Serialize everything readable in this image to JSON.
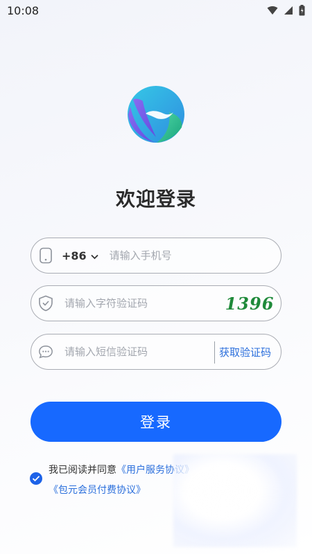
{
  "status_bar": {
    "time": "10:08"
  },
  "title": "欢迎登录",
  "phone": {
    "country_code": "+86",
    "placeholder": "请输入手机号"
  },
  "captcha": {
    "placeholder": "请输入字符验证码",
    "code": "1396"
  },
  "sms": {
    "placeholder": "请输入短信验证码",
    "button": "获取验证码"
  },
  "login_button": "登录",
  "agreement": {
    "prefix": "我已阅读并同意",
    "link1": "《用户服务协议》",
    "link2": "《包元会员付费协议》"
  },
  "colors": {
    "primary": "#1769ff",
    "link": "#2b6fdc",
    "captcha_text": "#1f8a3a"
  }
}
